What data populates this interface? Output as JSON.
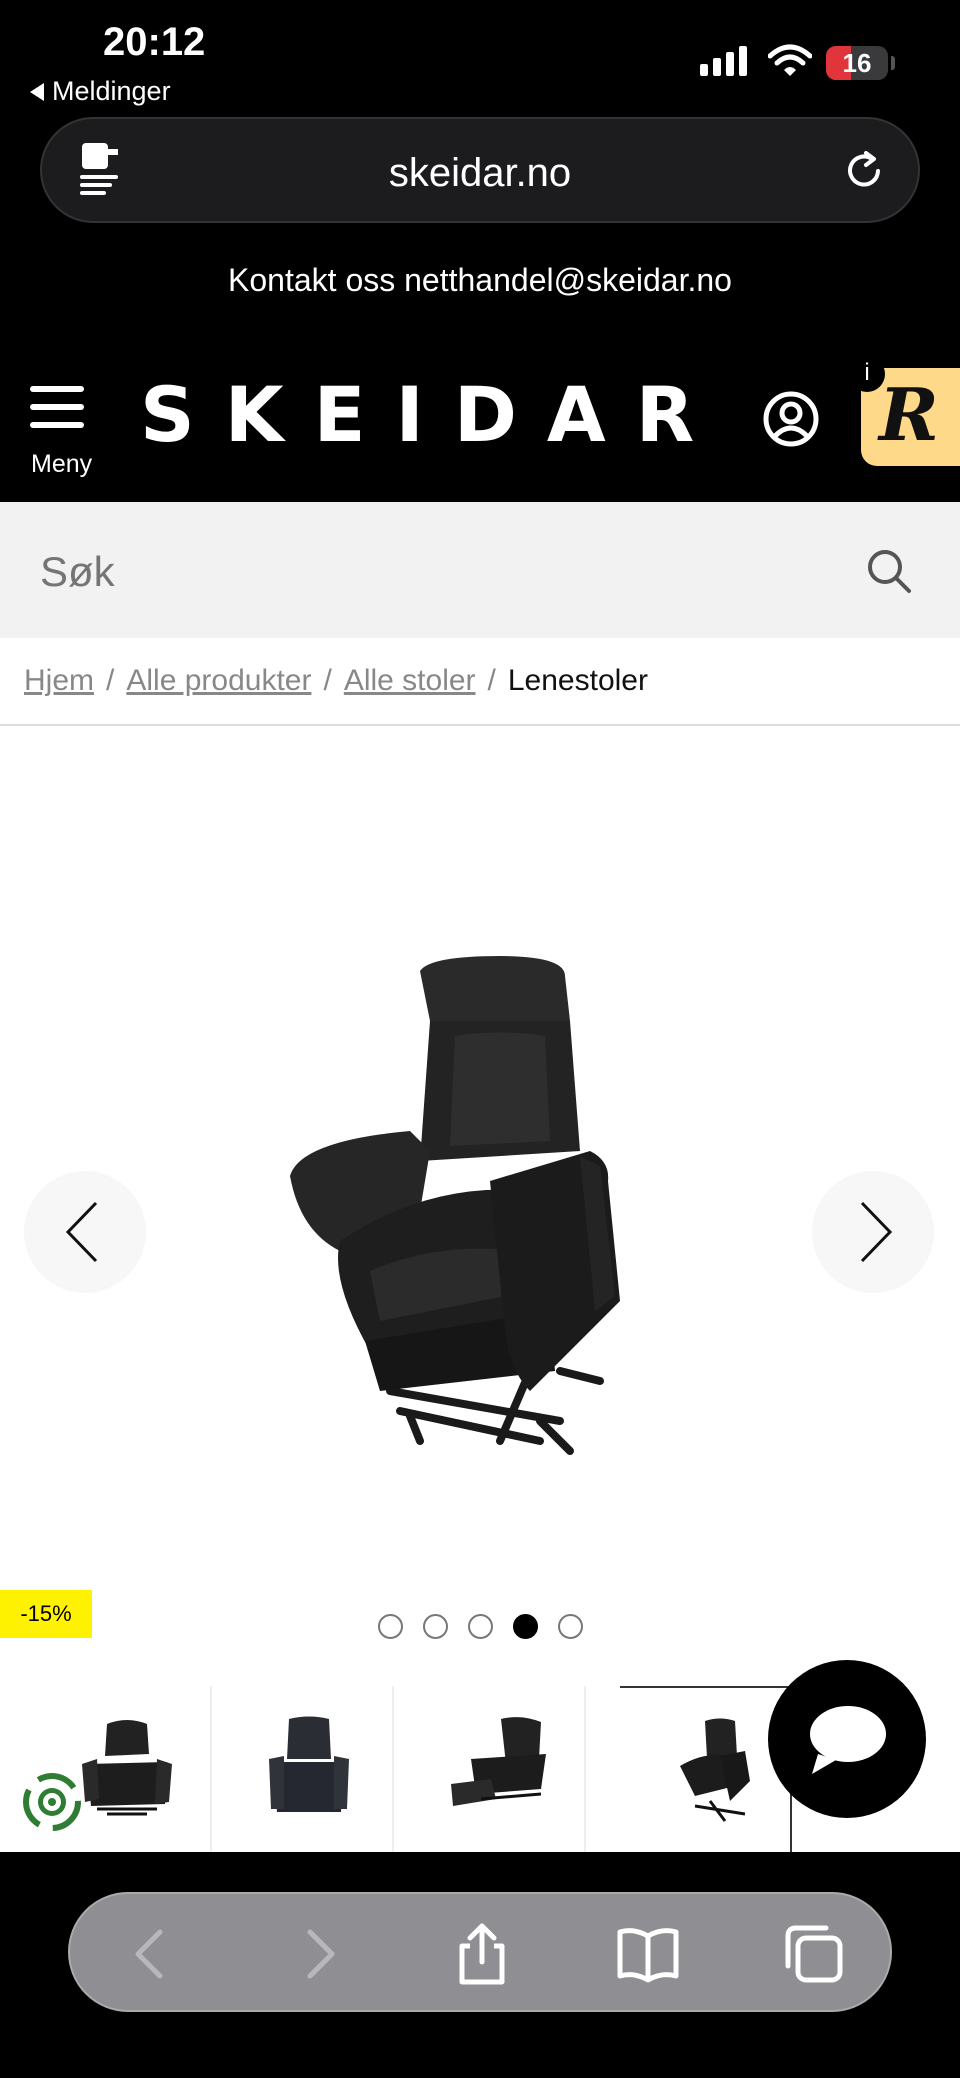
{
  "status_bar": {
    "time": "20:12",
    "back_app": "Meldinger",
    "battery_level": "16"
  },
  "browser": {
    "url": "skeidar.no"
  },
  "contact": {
    "text": "Kontakt oss netthandel@skeidar.no"
  },
  "header": {
    "menu_label": "Meny",
    "logo": "SKEIDAR",
    "badge_letter": "R",
    "badge_info": "i"
  },
  "search": {
    "placeholder": "Søk"
  },
  "breadcrumb": {
    "items": [
      "Hjem",
      "Alle produkter",
      "Alle stoler"
    ],
    "current": "Lenestoler",
    "separator": "/"
  },
  "product": {
    "discount": "-15%",
    "carousel_total": 5,
    "carousel_active": 4
  },
  "colors": {
    "accent_badge": "#ffd98a",
    "discount_bg": "#fff200",
    "battery_low": "#e0353b"
  }
}
